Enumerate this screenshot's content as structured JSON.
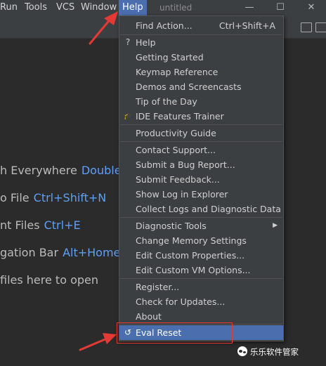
{
  "menubar": {
    "items": [
      "Run",
      "Tools",
      "VCS",
      "Window",
      "Help"
    ],
    "window_title": "untitled",
    "controls": {
      "minimize": "—",
      "maximize": "☐",
      "close": "✕"
    }
  },
  "hints": [
    {
      "text": "h Everywhere",
      "shortcut": "Double"
    },
    {
      "text": "o File",
      "shortcut": "Ctrl+Shift+N"
    },
    {
      "text": "nt Files",
      "shortcut": "Ctrl+E"
    },
    {
      "text": "gation Bar",
      "shortcut": "Alt+Home"
    },
    {
      "text": " files here to open",
      "shortcut": ""
    }
  ],
  "help_menu": {
    "items": [
      {
        "label": "Find Action...",
        "shortcut": "Ctrl+Shift+A",
        "icon": ""
      },
      {
        "label": "Help",
        "shortcut": "",
        "icon": "?"
      },
      {
        "label": "Getting Started",
        "shortcut": "",
        "icon": ""
      },
      {
        "label": "Keymap Reference",
        "shortcut": "",
        "icon": ""
      },
      {
        "label": "Demos and Screencasts",
        "shortcut": "",
        "icon": ""
      },
      {
        "label": "Tip of the Day",
        "shortcut": "",
        "icon": ""
      },
      {
        "label": "IDE Features Trainer",
        "shortcut": "",
        "icon": "🎓"
      },
      {
        "label": "Productivity Guide",
        "shortcut": "",
        "icon": ""
      },
      {
        "label": "Contact Support...",
        "shortcut": "",
        "icon": ""
      },
      {
        "label": "Submit a Bug Report...",
        "shortcut": "",
        "icon": ""
      },
      {
        "label": "Submit Feedback...",
        "shortcut": "",
        "icon": ""
      },
      {
        "label": "Show Log in Explorer",
        "shortcut": "",
        "icon": ""
      },
      {
        "label": "Collect Logs and Diagnostic Data",
        "shortcut": "",
        "icon": ""
      },
      {
        "label": "Diagnostic Tools",
        "shortcut": "",
        "icon": ""
      },
      {
        "label": "Change Memory Settings",
        "shortcut": "",
        "icon": ""
      },
      {
        "label": "Edit Custom Properties...",
        "shortcut": "",
        "icon": ""
      },
      {
        "label": "Edit Custom VM Options...",
        "shortcut": "",
        "icon": ""
      },
      {
        "label": "Register...",
        "shortcut": "",
        "icon": ""
      },
      {
        "label": "Check for Updates...",
        "shortcut": "",
        "icon": ""
      },
      {
        "label": "About",
        "shortcut": "",
        "icon": ""
      },
      {
        "label": "Eval Reset",
        "shortcut": "",
        "icon": "↺"
      }
    ],
    "submenu_arrow": "▶"
  },
  "watermark": {
    "text": "乐乐软件管家"
  },
  "colors": {
    "highlight": "#4b6eaf",
    "annotation": "#e53935",
    "shortcut": "#5da0f6"
  }
}
